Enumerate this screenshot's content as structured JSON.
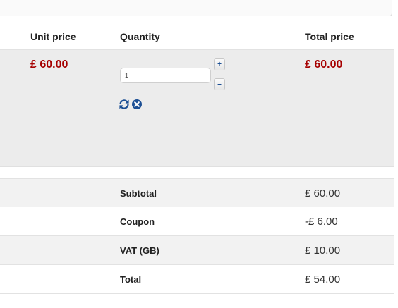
{
  "columns": {
    "unit_price": "Unit price",
    "quantity": "Quantity",
    "total_price": "Total price"
  },
  "product_row": {
    "unit_price": "£ 60.00",
    "quantity": "1",
    "increase_label": "+",
    "decrease_label": "–",
    "total_price": "£ 60.00",
    "update_icon": "refresh-icon",
    "remove_icon": "remove-circle-icon"
  },
  "summary": [
    {
      "label": "Subtotal",
      "value": "£ 60.00"
    },
    {
      "label": "Coupon",
      "value": "-£ 6.00"
    },
    {
      "label": "VAT (GB)",
      "value": "£ 10.00"
    },
    {
      "label": "Total",
      "value": "£ 54.00"
    }
  ],
  "colors": {
    "price": "#a60000",
    "icon": "#1c4f94",
    "row_shade": "#ececec"
  }
}
